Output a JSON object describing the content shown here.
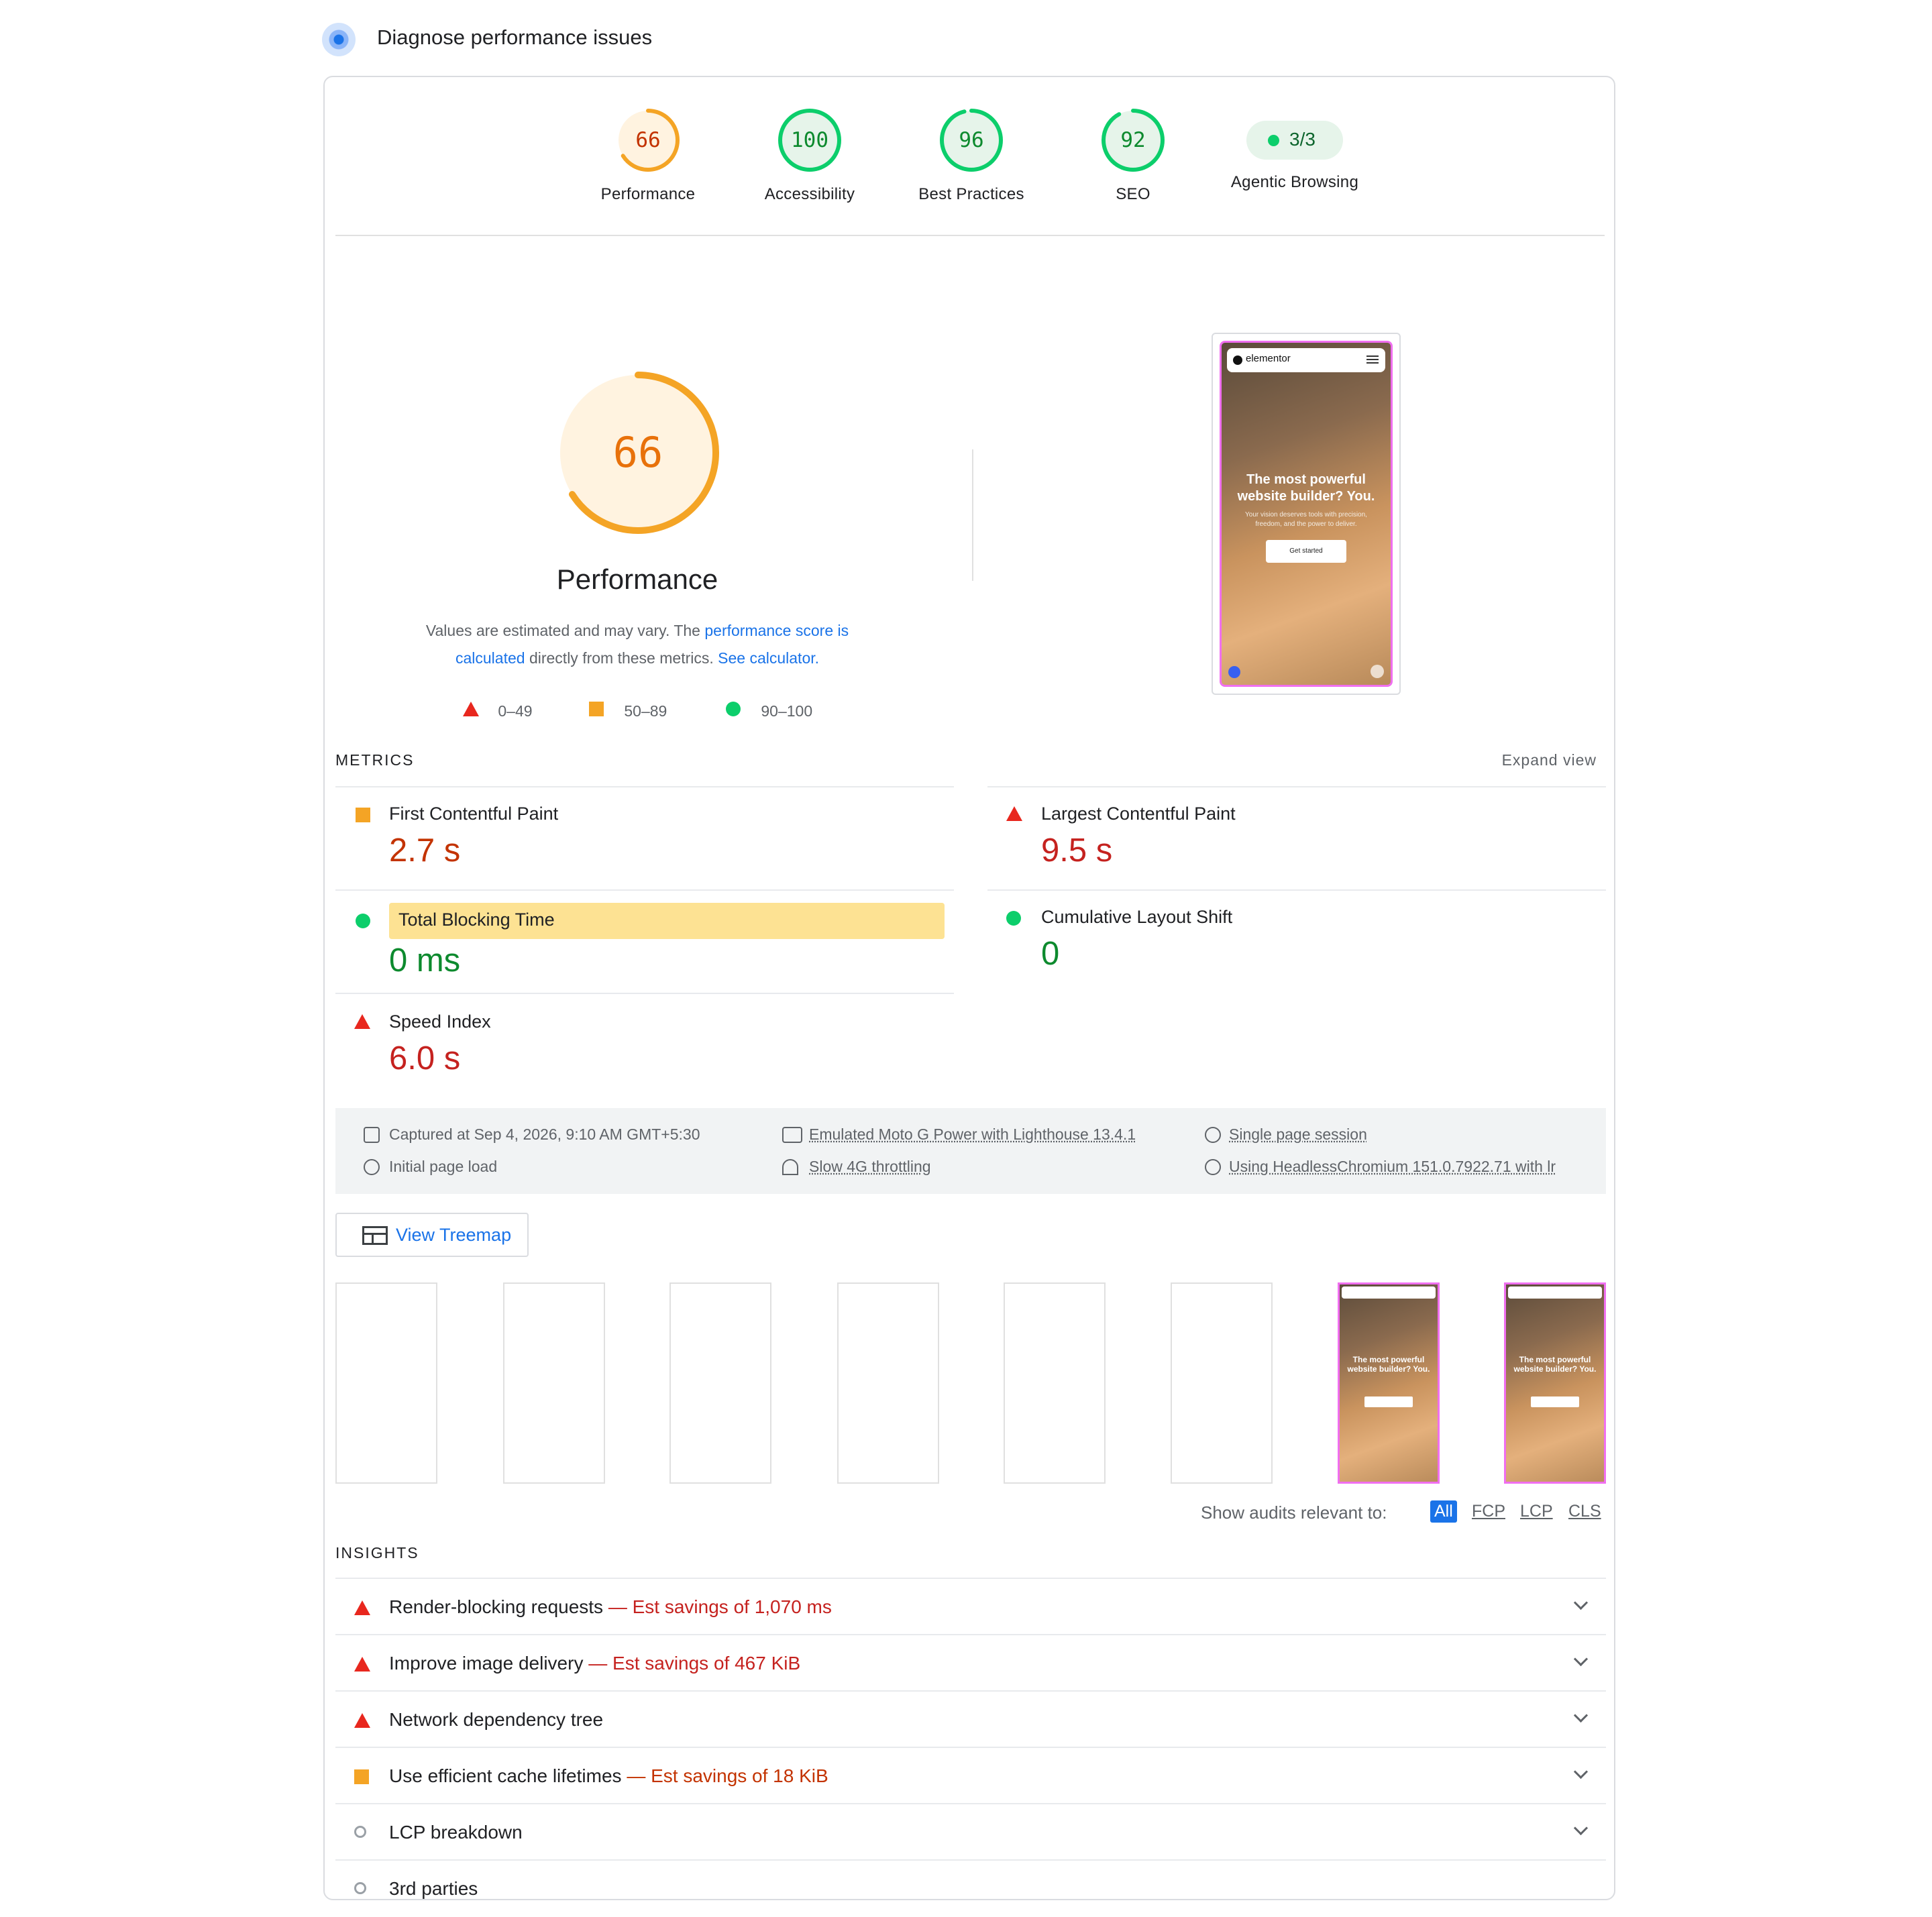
{
  "header": {
    "title": "Diagnose performance issues"
  },
  "scores": [
    {
      "label": "Performance",
      "value": "66",
      "color": "#e8710a",
      "bg": "#fff3e0",
      "stroke": "#f4a425",
      "fraction": 0.66
    },
    {
      "label": "Accessibility",
      "value": "100",
      "color": "#0d8a2e",
      "bg": "#e6f4ea",
      "stroke": "#0cce6b",
      "fraction": 1.0
    },
    {
      "label": "Best Practices",
      "value": "96",
      "color": "#0d8a2e",
      "bg": "#e6f4ea",
      "stroke": "#0cce6b",
      "fraction": 0.96
    },
    {
      "label": "SEO",
      "value": "92",
      "color": "#0d8a2e",
      "bg": "#e6f4ea",
      "stroke": "#0cce6b",
      "fraction": 0.92
    }
  ],
  "agentic": {
    "label": "Agentic Browsing",
    "value": "3/3"
  },
  "performance": {
    "score": "66",
    "score_fraction": 0.66,
    "title": "Performance",
    "desc_prefix": "Values are estimated and may vary. The ",
    "desc_link1": "performance score is calculated",
    "desc_middle": " directly from these metrics. ",
    "desc_link2": "See calculator.",
    "legend": [
      "0–49",
      "50–89",
      "90–100"
    ]
  },
  "screenshot": {
    "brand": "elementor",
    "headline": "The most powerful website builder? You.",
    "subtext": "Your vision deserves tools with precision, freedom, and the power to deliver.",
    "cta": "Get started"
  },
  "metrics": {
    "heading": "METRICS",
    "expand": "Expand view",
    "items": [
      {
        "label": "First Contentful Paint",
        "value": "2.7 s"
      },
      {
        "label": "Largest Contentful Paint",
        "value": "9.5 s"
      },
      {
        "label": "Total Blocking Time",
        "value": "0 ms"
      },
      {
        "label": "Cumulative Layout Shift",
        "value": "0"
      },
      {
        "label": "Speed Index",
        "value": "6.0 s"
      }
    ]
  },
  "info": {
    "captured": "Captured at Sep 4, 2026, 9:10 AM GMT+5:30",
    "device": "Emulated Moto G Power with Lighthouse 13.4.1",
    "session": "Single page session",
    "load": "Initial page load",
    "throttling": "Slow 4G throttling",
    "browser": "Using HeadlessChromium 151.0.7922.71 with lr"
  },
  "treemap": {
    "label": "View Treemap"
  },
  "filter": {
    "label": "Show audits relevant to:",
    "options": [
      "All",
      "FCP",
      "LCP",
      "CLS"
    ]
  },
  "insights": {
    "heading": "INSIGHTS",
    "items": [
      {
        "title": "Render-blocking requests",
        "savings": "— Est savings of 1,070 ms",
        "status": "fail"
      },
      {
        "title": "Improve image delivery",
        "savings": "— Est savings of 467 KiB",
        "status": "fail"
      },
      {
        "title": "Network dependency tree",
        "savings": "",
        "status": "fail"
      },
      {
        "title": "Use efficient cache lifetimes",
        "savings": "— Est savings of 18 KiB",
        "status": "average"
      },
      {
        "title": "LCP breakdown",
        "savings": "",
        "status": "info"
      },
      {
        "title": "3rd parties",
        "savings": "",
        "status": "info"
      }
    ]
  }
}
